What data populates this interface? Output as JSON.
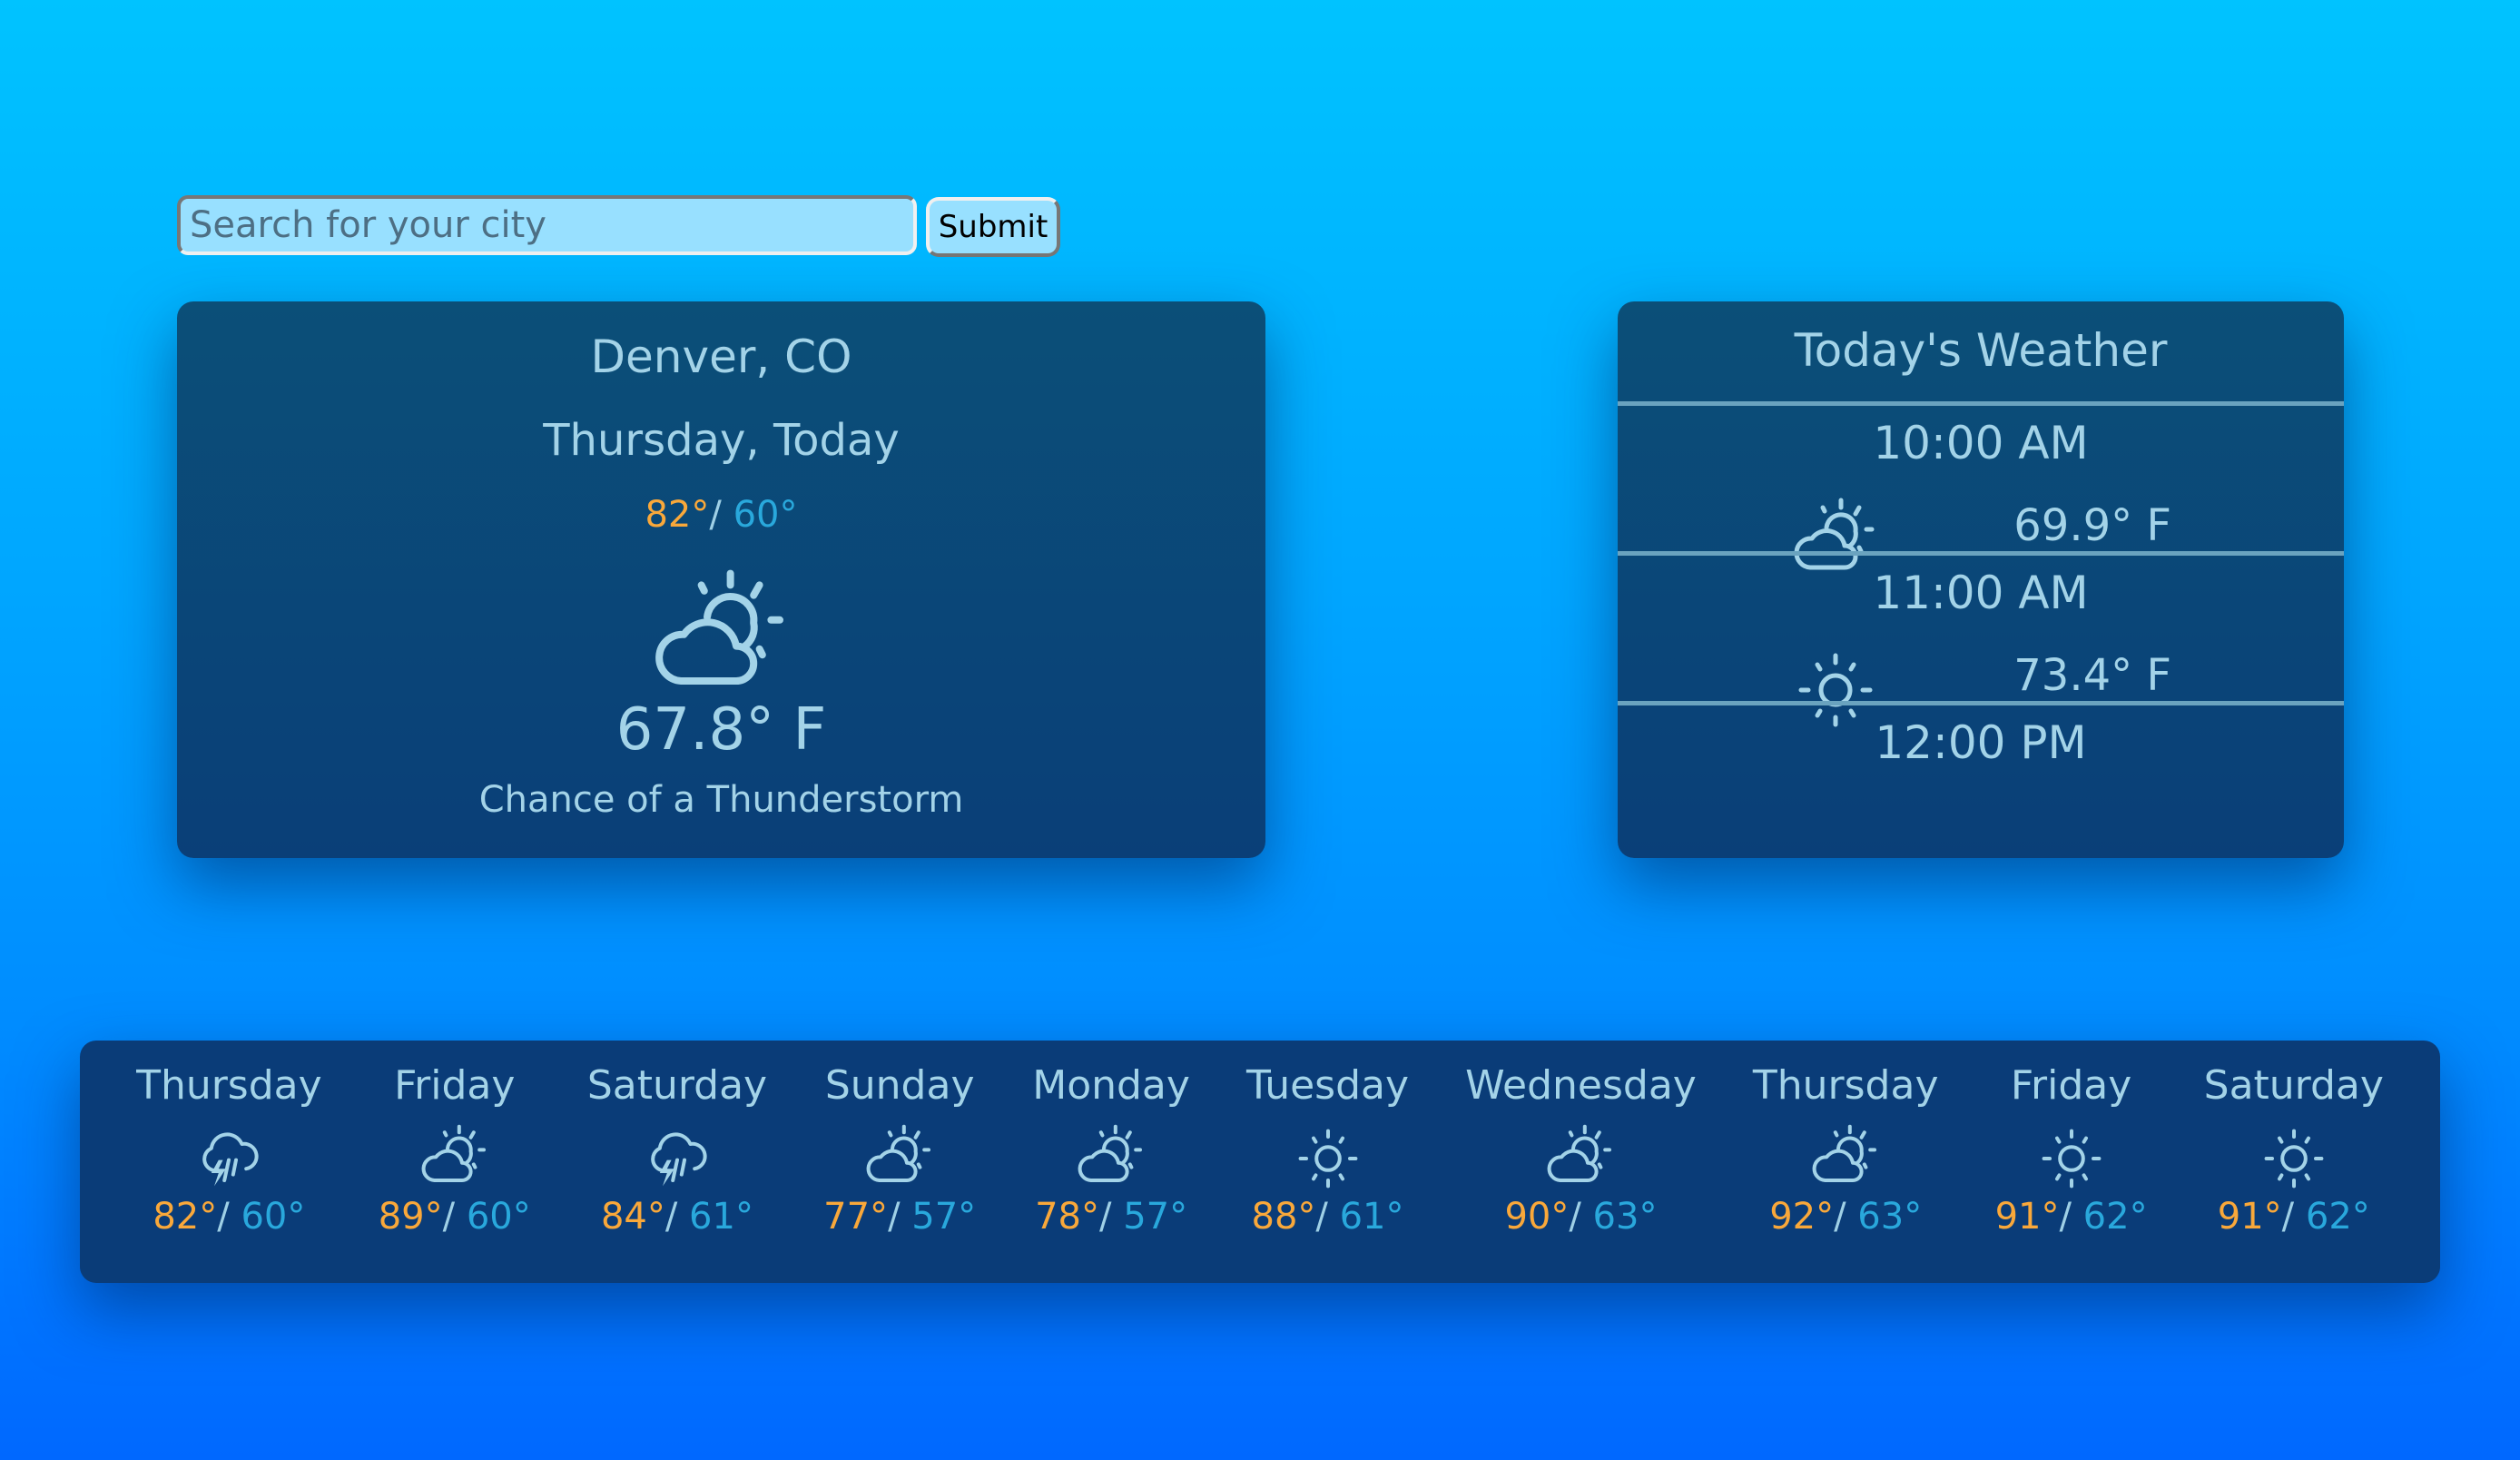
{
  "search": {
    "placeholder": "Search for your city",
    "value": "",
    "submit_label": "Submit"
  },
  "current": {
    "city": "Denver, CO",
    "date": "Thursday, Today",
    "high": "82°",
    "low": "60°",
    "separator": "/",
    "icon": "partly-cloudy-icon",
    "temperature": "67.8° F",
    "description": "Chance of a Thunderstorm"
  },
  "hourly": {
    "title": "Today's Weather",
    "hours": [
      {
        "time": "10:00 AM",
        "icon": "partly-cloudy-icon",
        "temp": "69.9° F"
      },
      {
        "time": "11:00 AM",
        "icon": "sunny-icon",
        "temp": "73.4° F"
      },
      {
        "time": "12:00 PM",
        "icon": "",
        "temp": ""
      }
    ]
  },
  "forecast": [
    {
      "day": "Thursday",
      "icon": "thunderstorm-icon",
      "high": "82°",
      "low": "60°"
    },
    {
      "day": "Friday",
      "icon": "partly-cloudy-icon",
      "high": "89°",
      "low": "60°"
    },
    {
      "day": "Saturday",
      "icon": "thunderstorm-icon",
      "high": "84°",
      "low": "61°"
    },
    {
      "day": "Sunday",
      "icon": "partly-cloudy-icon",
      "high": "77°",
      "low": "57°"
    },
    {
      "day": "Monday",
      "icon": "partly-cloudy-icon",
      "high": "78°",
      "low": "57°"
    },
    {
      "day": "Tuesday",
      "icon": "sunny-icon",
      "high": "88°",
      "low": "61°"
    },
    {
      "day": "Wednesday",
      "icon": "partly-cloudy-icon",
      "high": "90°",
      "low": "63°"
    },
    {
      "day": "Thursday",
      "icon": "partly-cloudy-icon",
      "high": "92°",
      "low": "63°"
    },
    {
      "day": "Friday",
      "icon": "sunny-icon",
      "high": "91°",
      "low": "62°"
    },
    {
      "day": "Saturday",
      "icon": "sunny-icon",
      "high": "91°",
      "low": "62°"
    }
  ],
  "colors": {
    "high": "#f9a83a",
    "low": "#29a8dc",
    "text": "#a3d3e8",
    "card": "#0b4f78"
  }
}
